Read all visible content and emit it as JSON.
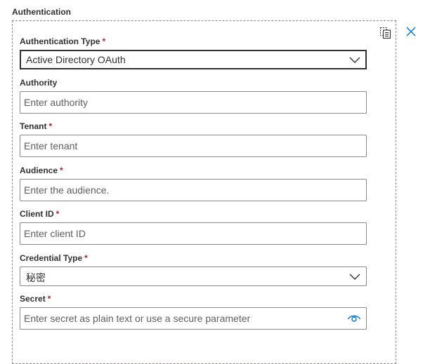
{
  "section": {
    "title": "Authentication"
  },
  "icons": {
    "copy": "copy-icon",
    "close": "close-icon",
    "chevron": "chevron-down-icon",
    "eye": "eye-icon"
  },
  "colors": {
    "required": "#a4262c",
    "accent": "#0078d4",
    "border": "#8a8886"
  },
  "fields": {
    "auth_type": {
      "label": "Authentication Type",
      "required": "*",
      "value": "Active Directory OAuth"
    },
    "authority": {
      "label": "Authority",
      "placeholder": "Enter authority"
    },
    "tenant": {
      "label": "Tenant",
      "required": "*",
      "placeholder": "Enter tenant"
    },
    "audience": {
      "label": "Audience",
      "required": "*",
      "placeholder": "Enter the audience."
    },
    "client_id": {
      "label": "Client ID",
      "required": "*",
      "placeholder": "Enter client ID"
    },
    "credential_type": {
      "label": "Credential Type",
      "required": "*",
      "value": "秘密"
    },
    "secret": {
      "label": "Secret",
      "required": "*",
      "placeholder": "Enter secret as plain text or use a secure parameter"
    }
  }
}
